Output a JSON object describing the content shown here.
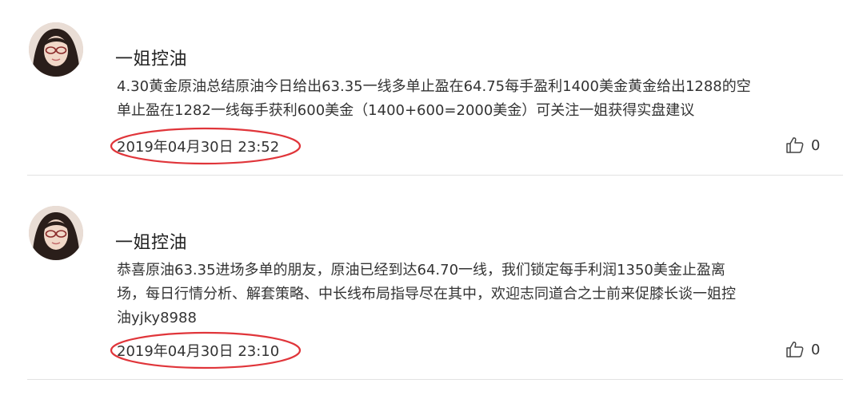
{
  "comments": [
    {
      "username": "一姐控油",
      "text_lines": [
        "4.30黄金原油总结原油今日给出63.35一线多单止盈在64.75每手盈利1400美金黄金给出1288的空",
        "单止盈在1282一线每手获利600美金（1400+600=2000美金）可关注一姐获得实盘建议"
      ],
      "timestamp": "2019年04月30日 23:52",
      "likes": "0"
    },
    {
      "username": "一姐控油",
      "text_lines": [
        "恭喜原油63.35进场多单的朋友，原油已经到达64.70一线，我们锁定每手利润1350美金止盈离",
        "场，每日行情分析、解套策略、中长线布局指导尽在其中，欢迎志同道合之士前来促膝长谈一姐控",
        "油yjky8988"
      ],
      "timestamp": "2019年04月30日 23:10",
      "likes": "0"
    }
  ],
  "colors": {
    "annotation_circle": "#e0353a",
    "divider": "#e2e2e2",
    "text": "#333333"
  },
  "icons": {
    "like": "thumbs-up-icon",
    "avatar": "avatar"
  }
}
